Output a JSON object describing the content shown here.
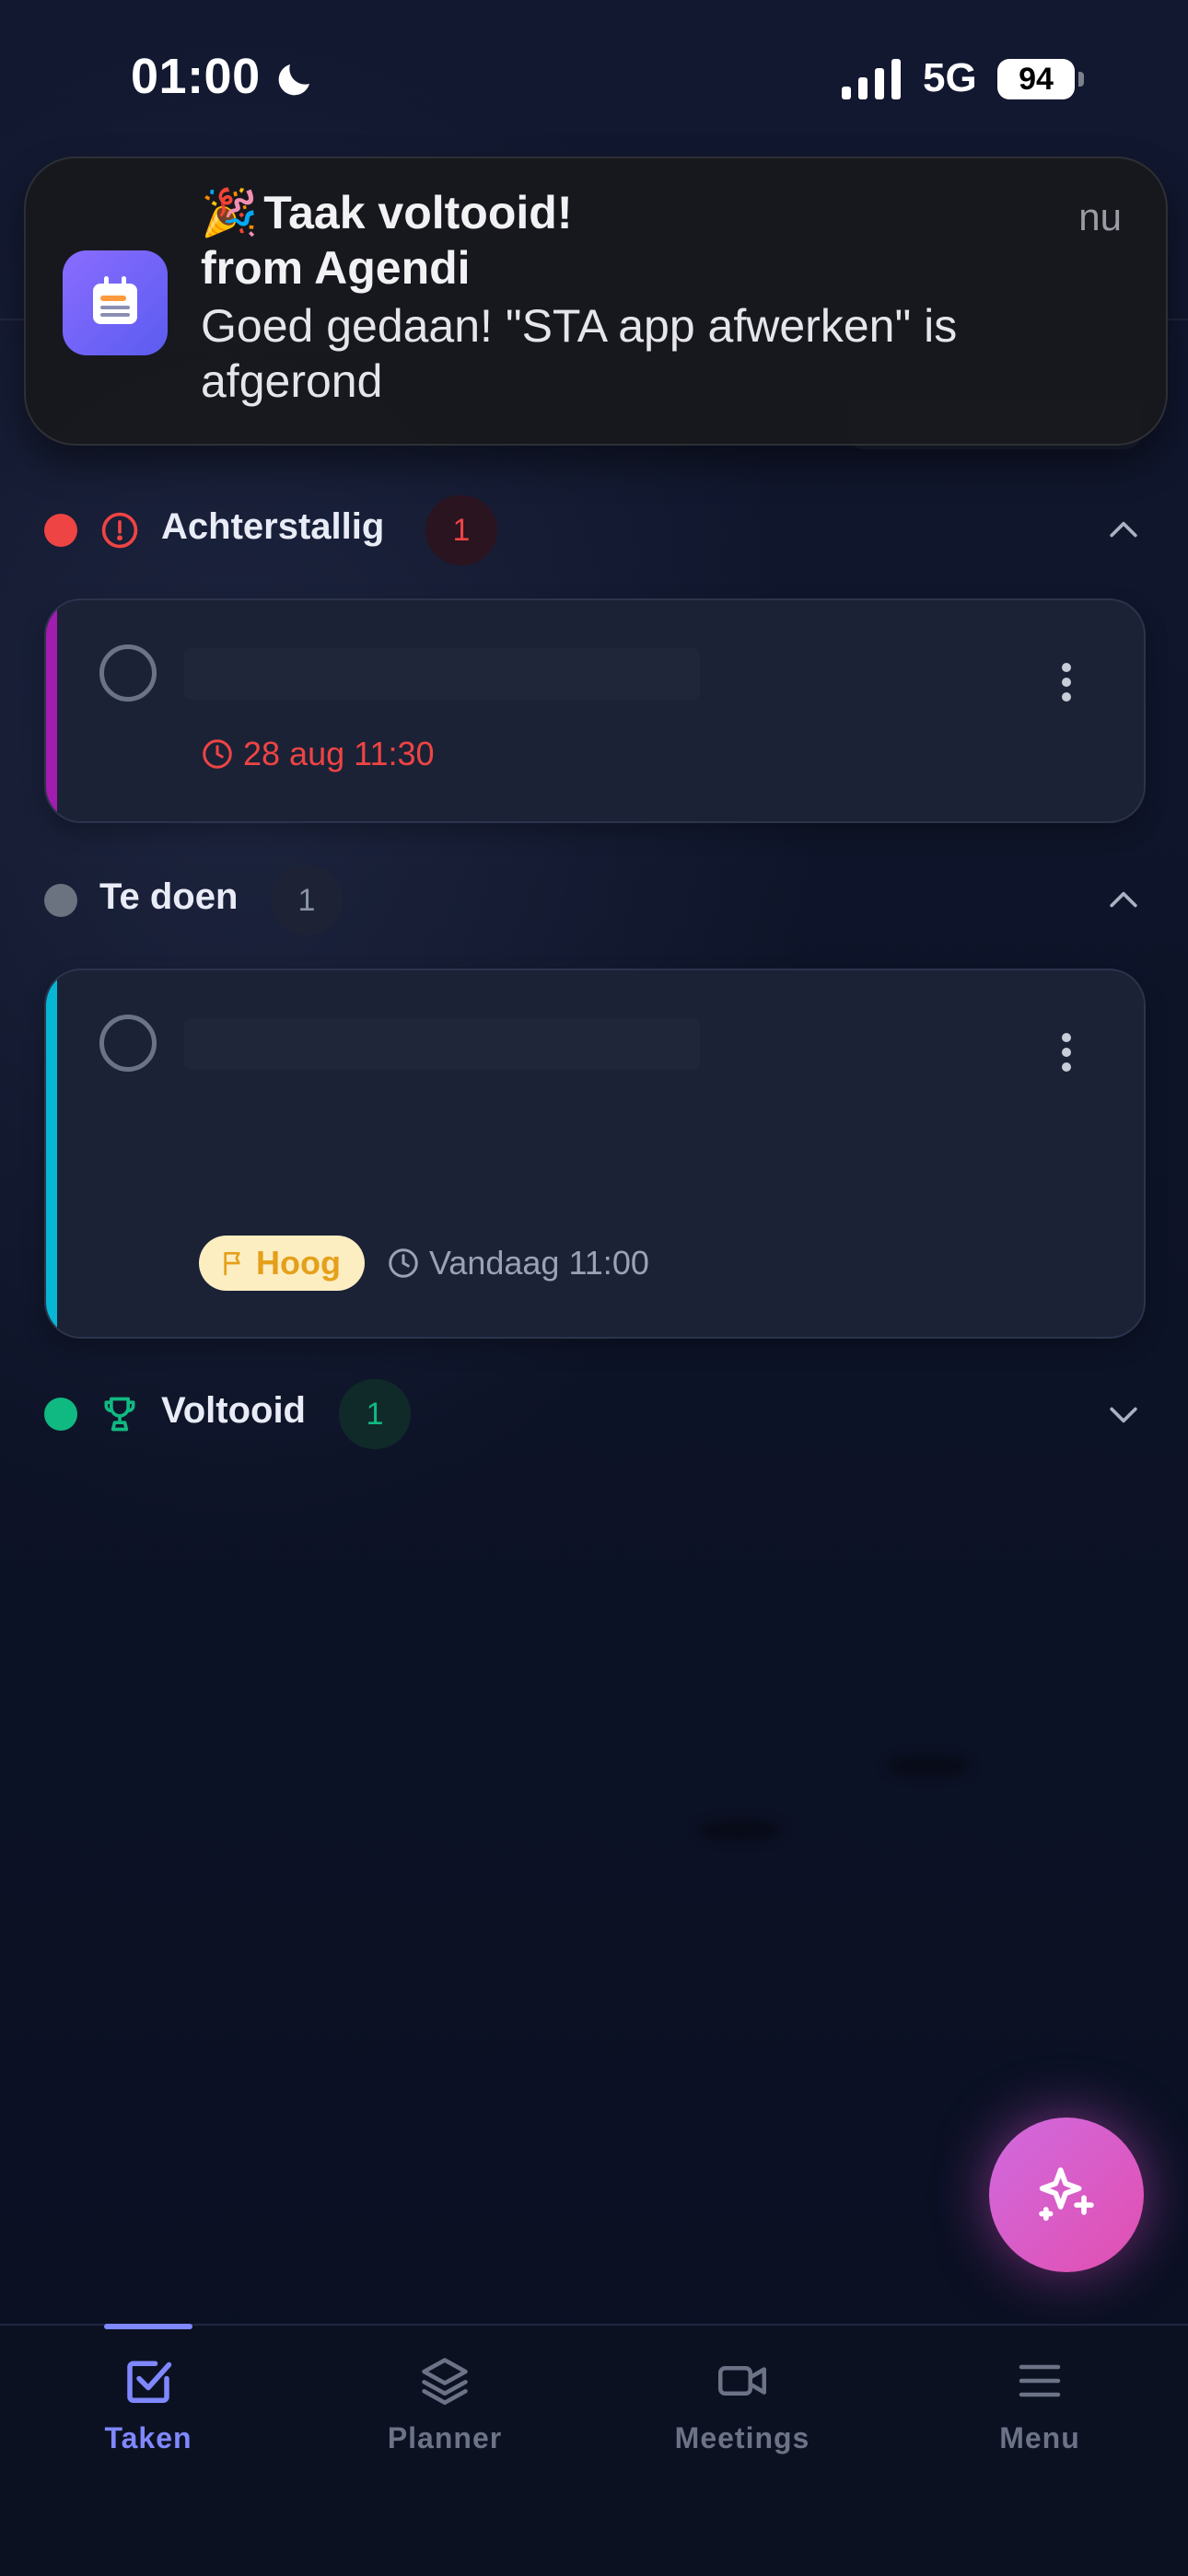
{
  "status_bar": {
    "time": "01:00",
    "network": "5G",
    "battery": "94"
  },
  "notification": {
    "emoji": "🎉",
    "title": "Taak voltooid!",
    "subtitle": "from Agendi",
    "body": "Goed gedaan! \"STA app afwerken\" is afgerond",
    "time": "nu"
  },
  "sections": {
    "overdue": {
      "label": "Achterstallig",
      "count": "1",
      "color": "#ef4444",
      "tasks": [
        {
          "title": "",
          "time": "28 aug 11:30",
          "accent": "#a21caf"
        }
      ]
    },
    "todo": {
      "label": "Te doen",
      "count": "1",
      "color": "#6b7280",
      "tasks": [
        {
          "title": "",
          "priority": "Hoog",
          "time": "Vandaag 11:00",
          "accent": "#06b6d4"
        }
      ]
    },
    "done": {
      "label": "Voltooid",
      "count": "1",
      "color": "#10b981"
    }
  },
  "bottom_nav": {
    "items": [
      {
        "label": "Taken",
        "icon": "checkbox-icon",
        "active": true
      },
      {
        "label": "Planner",
        "icon": "layers-icon",
        "active": false
      },
      {
        "label": "Meetings",
        "icon": "video-icon",
        "active": false
      },
      {
        "label": "Menu",
        "icon": "menu-icon",
        "active": false
      }
    ]
  },
  "fab": {
    "icon": "sparkle-icon",
    "color": "#d85ec8"
  },
  "colors": {
    "accent": "#7f88ff",
    "background": "#0b1022",
    "card": "#1b2236"
  }
}
